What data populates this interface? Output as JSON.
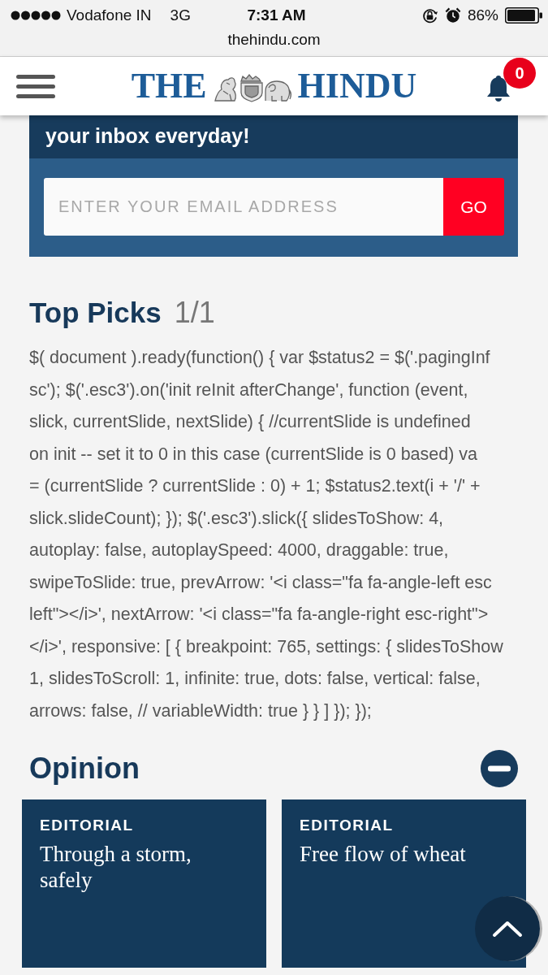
{
  "status_bar": {
    "carrier": "Vodafone IN",
    "network": "3G",
    "time": "7:31 AM",
    "battery": "86%",
    "url": "thehindu.com"
  },
  "header": {
    "logo_left": "THE",
    "logo_right": "HINDU",
    "notification_count": "0"
  },
  "newsletter": {
    "heading": "your inbox everyday!",
    "email_field": {
      "placeholder": "ENTER YOUR EMAIL ADDRESS"
    },
    "submit_button": "GO"
  },
  "top_picks": {
    "title": "Top Picks",
    "pager": "1/1",
    "code_lines": [
      "$( document ).ready(function() { var $status2 = $('.pagingInf",
      "sc'); $('.esc3').on('init reInit afterChange', function (event,",
      "slick, currentSlide, nextSlide) { //currentSlide is undefined",
      "on init -- set it to 0 in this case (currentSlide is 0 based) va",
      "= (currentSlide ? currentSlide : 0) + 1; $status2.text(i + '/' +",
      "slick.slideCount); }); $('.esc3').slick({ slidesToShow: 4,",
      "autoplay: false, autoplaySpeed: 4000, draggable: true,",
      "swipeToSlide: true, prevArrow: '<i class=\"fa fa-angle-left esc",
      "left\"></i>', nextArrow: '<i class=\"fa fa-angle-right esc-right\">",
      "</i>', responsive: [ { breakpoint: 765, settings: { slidesToShow",
      "1, slidesToScroll: 1, infinite: true, dots: false, vertical: false,",
      "arrows: false, // variableWidth: true } } ] }); });"
    ]
  },
  "opinion": {
    "title": "Opinion",
    "expanded": true,
    "cards": [
      {
        "category": "EDITORIAL",
        "headline": "Through a storm, safely"
      },
      {
        "category": "EDITORIAL",
        "headline": "Free flow of wheat"
      }
    ]
  }
}
